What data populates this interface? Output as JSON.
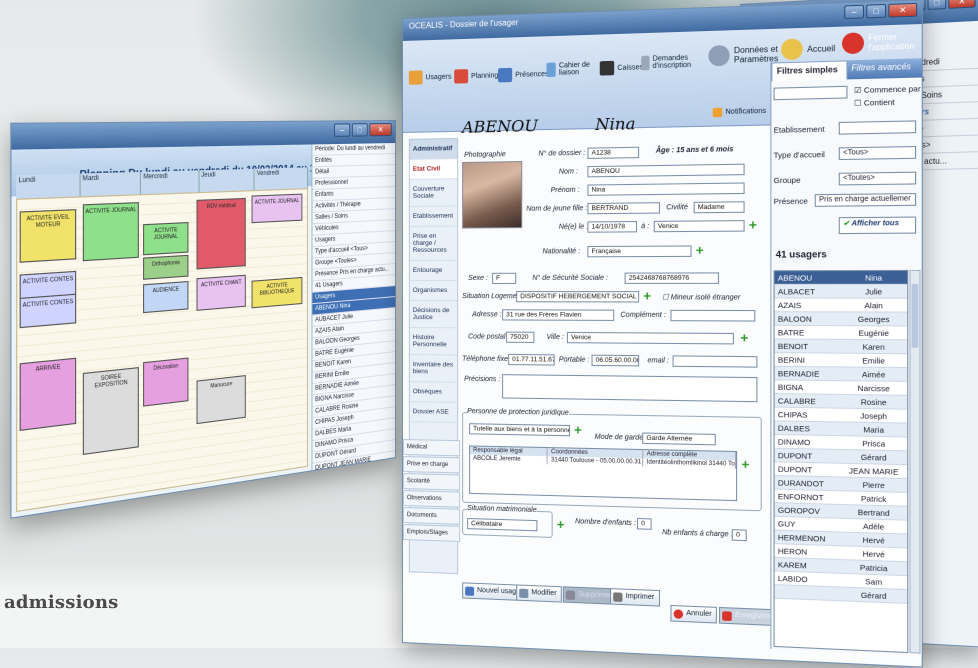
{
  "brand_text": "admissions",
  "planning_window": {
    "title": "Planning Du lundi au vendredi du 10/02/2014 au 14/02/2014",
    "columns": [
      "Lundi",
      "Mardi",
      "Mercredi",
      "Jeudi",
      "Vendredi"
    ],
    "events": [
      {
        "label": "ACTIVITE EVEIL MOTEUR",
        "color": "#f1e36a"
      },
      {
        "label": "ACTIVITE JOURNAL",
        "color": "#8fe08a"
      },
      {
        "label": "ACTIVITE JOURNAL",
        "color": "#8fe08a"
      },
      {
        "label": "RDV médical",
        "color": "#e05a6a"
      },
      {
        "label": "ACTIVITE JOURNAL",
        "color": "#e8c2f0"
      },
      {
        "label": "ACTIVITE CONTES",
        "color": "#cfd3ff"
      },
      {
        "label": "Orthophonie",
        "color": "#9cd08a"
      },
      {
        "label": "AUDIENCE",
        "color": "#c2d7f5"
      },
      {
        "label": "ACTIVITE CHANT",
        "color": "#e8c2f0"
      },
      {
        "label": "ACTIVITE BIBLIOTHEQUE",
        "color": "#f1e36a"
      },
      {
        "label": "ACTIVITE CONTES",
        "color": "#cfd3ff"
      },
      {
        "label": "ARRIVEE",
        "color": "#e6a0e0"
      },
      {
        "label": "Décoration",
        "color": "#e6a0e0"
      },
      {
        "label": "SOIREE EXPOSITION",
        "color": "#dcdcdc"
      },
      {
        "label": "Manucure",
        "color": "#dcdcdc"
      }
    ],
    "side": {
      "periode_label": "Période",
      "periode_value": "Du lundi au vendredi",
      "entites_label": "Entités",
      "detail_label": "Détail",
      "tabs": [
        "Professionnel",
        "Enfants",
        "Activités / Thérapie",
        "Salles / Soins",
        "Véhicules",
        "Usagers"
      ],
      "type_label": "Type d'accueil",
      "type_value": "<Tous>",
      "groupe_label": "Groupe",
      "groupe_value": "<Toutes>",
      "presence_label": "Présence",
      "presence_value": "Pris en charge actu...",
      "count": "41 Usagers",
      "header": "Usagers",
      "users": [
        "ABENOU Nina",
        "AUBACET Julie",
        "AZAIS Alain",
        "BALOON Georges",
        "BATRE Eugénie",
        "BENOIT Karen",
        "BERINI Emilie",
        "BERNADIE Aimée",
        "BIGNA Narcisse",
        "CALABRE Rosine",
        "CHIPAS Joseph",
        "DALBES Maria",
        "DINAMO Prisca",
        "DUPONT Gérard",
        "DUPONT JEAN MARIE",
        "DURANDOT Pierre",
        "ENFORNOT Patrick",
        "GOROPOV Bertrand",
        "GUY Adèle",
        "HERMENON Hervé"
      ]
    }
  },
  "back_window": {
    "period_value": "au vendredi",
    "tabs": [
      "Enfants",
      "Salles/Soins",
      "Usagers"
    ],
    "fields": [
      "<Tous>",
      "<Toutes>",
      "charge actu..."
    ]
  },
  "main_window": {
    "title": "OCEALIS - Dossier de l'usager",
    "ribbon": {
      "usagers": "Usagers",
      "planning": "Planning",
      "presences": "Présences",
      "cahier": "Cahier de liaison",
      "caisses": "Caisses",
      "demandes": "Demandes d'inscription",
      "donnees": "Données et Paramètres",
      "accueil": "Accueil",
      "fermer": "Fermer l'application",
      "notifications": "Notifications"
    },
    "patient": {
      "last": "ABENOU",
      "first": "Nina"
    },
    "nav": [
      "Administratif",
      "Etat Civil",
      "Couverture Sociale",
      "Etablissement",
      "Prise en charge / Ressources",
      "Entourage",
      "Organismes",
      "Décisions de Justice",
      "Histoire Personnelle",
      "Inventaire des biens",
      "Obsèques",
      "Dossier ASE"
    ],
    "nav2": [
      "Médical",
      "Prise en charge",
      "Scolarité",
      "Observations",
      "Documents",
      "Emplois/Stages"
    ],
    "form": {
      "photo_label": "Photographie",
      "dossier_label": "N° de dossier :",
      "dossier_value": "A1238",
      "age_text": "Âge : 15 ans et 6 mois",
      "nom_label": "Nom :",
      "nom_value": "ABENOU",
      "prenom_label": "Prénom :",
      "prenom_value": "Nina",
      "jeune_fille_label": "Nom de jeune fille :",
      "jeune_fille_value": "BERTRAND",
      "civilite_label": "Civilité",
      "civilite_value": "Madame",
      "ne_le_label": "Né(e) le :",
      "ne_le_value": "14/10/1978",
      "a_label": "à :",
      "a_value": "Venice",
      "nationalite_label": "Nationalité :",
      "nationalite_value": "Française",
      "sexe_label": "Sexe :",
      "sexe_value": "F",
      "secu_label": "N° de Sécurité Sociale :",
      "secu_value": "2542468768768976",
      "situation_label": "Situation Logement :",
      "situation_value": "DISPOSITIF HEBERGEMENT SOCIAL",
      "mineur_label": "Mineur isolé étranger",
      "adresse_label": "Adresse :",
      "adresse_value": "31 rue des Frères Flavien",
      "complement_label": "Complément :",
      "cp_label": "Code postal :",
      "cp_value": "75020",
      "ville_label": "Ville :",
      "ville_value": "Venice",
      "tel_label": "Téléphone fixe :",
      "tel_value": "01.77.11.51.67",
      "portable_label": "Portable :",
      "portable_value": "06.05.60.00.00",
      "email_label": "email :",
      "precisions_label": "Précisions :",
      "protection_legend": "Personne de protection juridique",
      "protection_value": "Tutelle aux biens et à la personne",
      "garde_label": "Mode de garde :",
      "garde_value": "Garde Alternée",
      "resp_headers": [
        "Responsable légal",
        "Coordonnées",
        "Adresse complète"
      ],
      "resp_row": [
        "ABCOLE Jeremie",
        "31440 Toulouse - 05.00.00.00.31 - 06.00.00.00.00",
        "Identitéolinthomlikinol 31440 Toulouse"
      ],
      "matrimoniale_legend": "Situation matrimoniale",
      "matrimoniale_value": "Célibataire",
      "enfants_label": "Nombre d'enfants :",
      "enfants_value": "0",
      "charge_label": "Nb enfants à charge :",
      "charge_value": "0"
    },
    "buttons": {
      "record": "Nouvel usager",
      "modifier": "Modifier",
      "supprimer": "Supprimer",
      "imprimer": "Imprimer",
      "annuler": "Annuler",
      "enregistrer": "Enregistrer/Clôturer"
    },
    "filters": {
      "tab_simple": "Filtres simples",
      "tab_advanced": "Filtres avancés",
      "commence_par": "Commence par",
      "contient": "Contient",
      "etab_label": "Etablissement",
      "type_label": "Type d'accueil",
      "type_value": "<Tous>",
      "groupe_label": "Groupe",
      "groupe_value": "<Toutes>",
      "presence_label": "Présence",
      "presence_value": "Pris en charge actuellemer",
      "afficher": "Afficher tous",
      "count": "41 usagers",
      "users": [
        [
          "ABENOU",
          "Nina"
        ],
        [
          "ALBACET",
          "Julie"
        ],
        [
          "AZAIS",
          "Alain"
        ],
        [
          "BALOON",
          "Georges"
        ],
        [
          "BATRE",
          "Eugénie"
        ],
        [
          "BENOIT",
          "Karen"
        ],
        [
          "BERINI",
          "Emilie"
        ],
        [
          "BERNADIE",
          "Aimée"
        ],
        [
          "BIGNA",
          "Narcisse"
        ],
        [
          "CALABRE",
          "Rosine"
        ],
        [
          "CHIPAS",
          "Joseph"
        ],
        [
          "DALBES",
          "Maria"
        ],
        [
          "DINAMO",
          "Prisca"
        ],
        [
          "DUPONT",
          "Gérard"
        ],
        [
          "DUPONT",
          "JEAN MARIE"
        ],
        [
          "DURANDOT",
          "Pierre"
        ],
        [
          "ENFORNOT",
          "Patrick"
        ],
        [
          "GOROPOV",
          "Bertrand"
        ],
        [
          "GUY",
          "Adèle"
        ],
        [
          "HERMENON",
          "Hervé"
        ],
        [
          "HERON",
          "Hervé"
        ],
        [
          "KAREM",
          "Patricia"
        ],
        [
          "LABIDO",
          "Sam"
        ],
        [
          "",
          "Gérard"
        ]
      ]
    }
  }
}
